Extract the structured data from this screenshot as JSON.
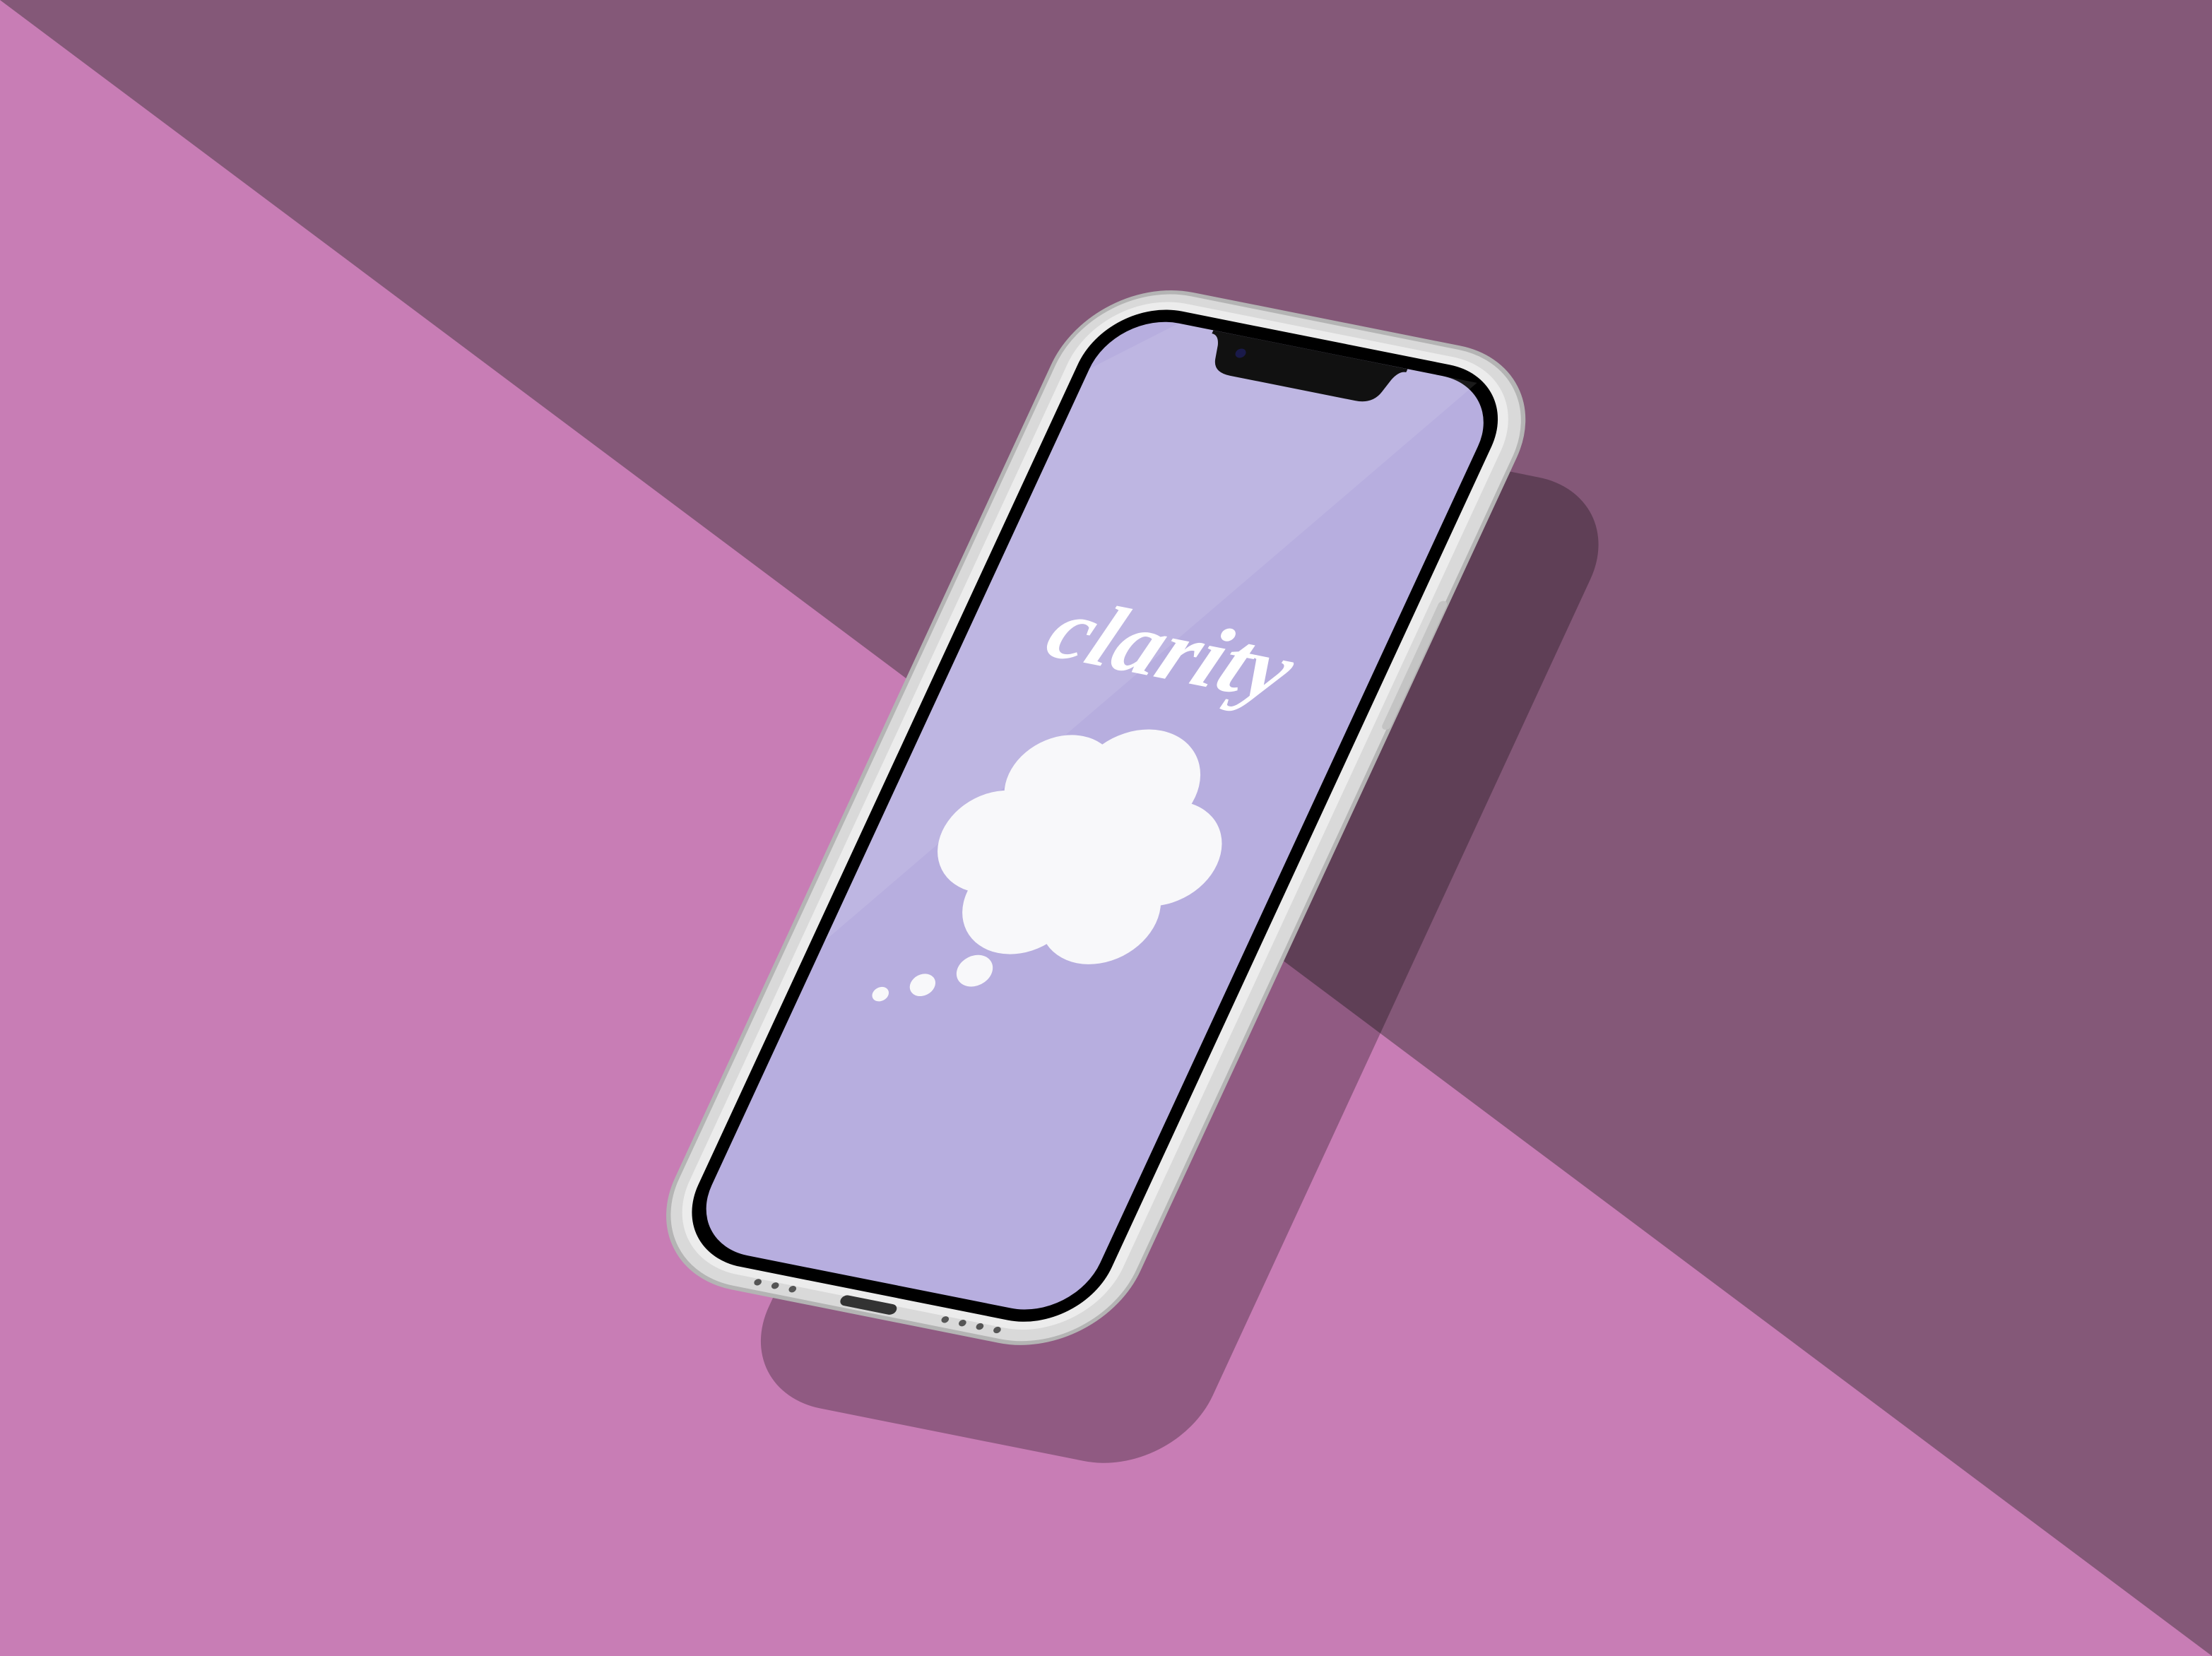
{
  "app": {
    "name": "clarity",
    "icon": "thought-cloud-icon"
  },
  "colors": {
    "background_light": "#c87db5",
    "background_dark": "#845878",
    "screen": "#b7aedf",
    "logo": "#ffffff",
    "cloud": "#f8f8fa",
    "frame": "#d6d6d6"
  }
}
